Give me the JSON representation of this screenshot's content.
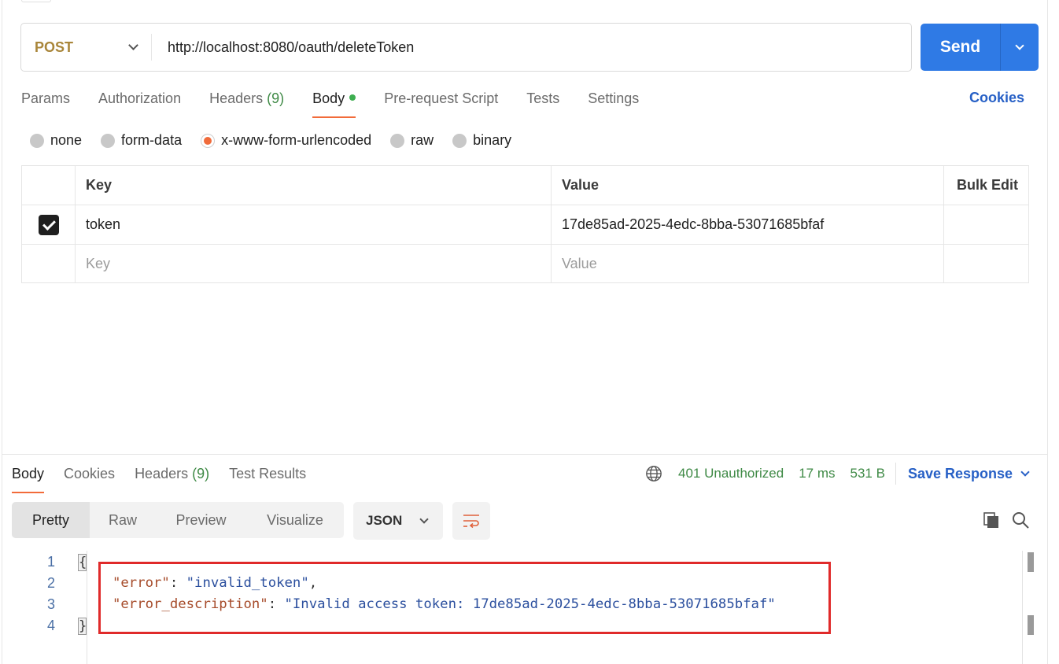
{
  "request": {
    "method": "POST",
    "url": "http://localhost:8080/oauth/deleteToken",
    "send_label": "Send"
  },
  "request_tabs": [
    {
      "label": "Params"
    },
    {
      "label": "Authorization"
    },
    {
      "label": "Headers",
      "count": "(9)"
    },
    {
      "label": "Body"
    },
    {
      "label": "Pre-request Script"
    },
    {
      "label": "Tests"
    },
    {
      "label": "Settings"
    }
  ],
  "cookies_link": "Cookies",
  "body_types": [
    "none",
    "form-data",
    "x-www-form-urlencoded",
    "raw",
    "binary"
  ],
  "body_type_selected": "x-www-form-urlencoded",
  "kv_table": {
    "headers": {
      "key": "Key",
      "value": "Value",
      "bulk": "Bulk Edit"
    },
    "rows": [
      {
        "key": "token",
        "value": "17de85ad-2025-4edc-8bba-53071685bfaf"
      }
    ],
    "placeholder": {
      "key": "Key",
      "value": "Value"
    }
  },
  "response_tabs": [
    {
      "label": "Body"
    },
    {
      "label": "Cookies"
    },
    {
      "label": "Headers",
      "count": "(9)"
    },
    {
      "label": "Test Results"
    }
  ],
  "response_meta": {
    "status": "401 Unauthorized",
    "time": "17 ms",
    "size": "531 B",
    "save_label": "Save Response"
  },
  "view_modes": [
    "Pretty",
    "Raw",
    "Preview",
    "Visualize"
  ],
  "format": "JSON",
  "code": {
    "line_numbers": [
      "1",
      "2",
      "3",
      "4"
    ],
    "open_brace": "{",
    "close_brace": "}",
    "line2_key": "\"error\"",
    "line2_value": "\"invalid_token\"",
    "line3_key": "\"error_description\"",
    "line3_value": "\"Invalid access token: 17de85ad-2025-4edc-8bba-53071685bfaf\""
  },
  "colors": {
    "accent": "#f26b3a",
    "send": "#2f7ae5",
    "link": "#2760c6",
    "status_green": "#3f8a46",
    "highlight_box": "#e02a2a"
  }
}
